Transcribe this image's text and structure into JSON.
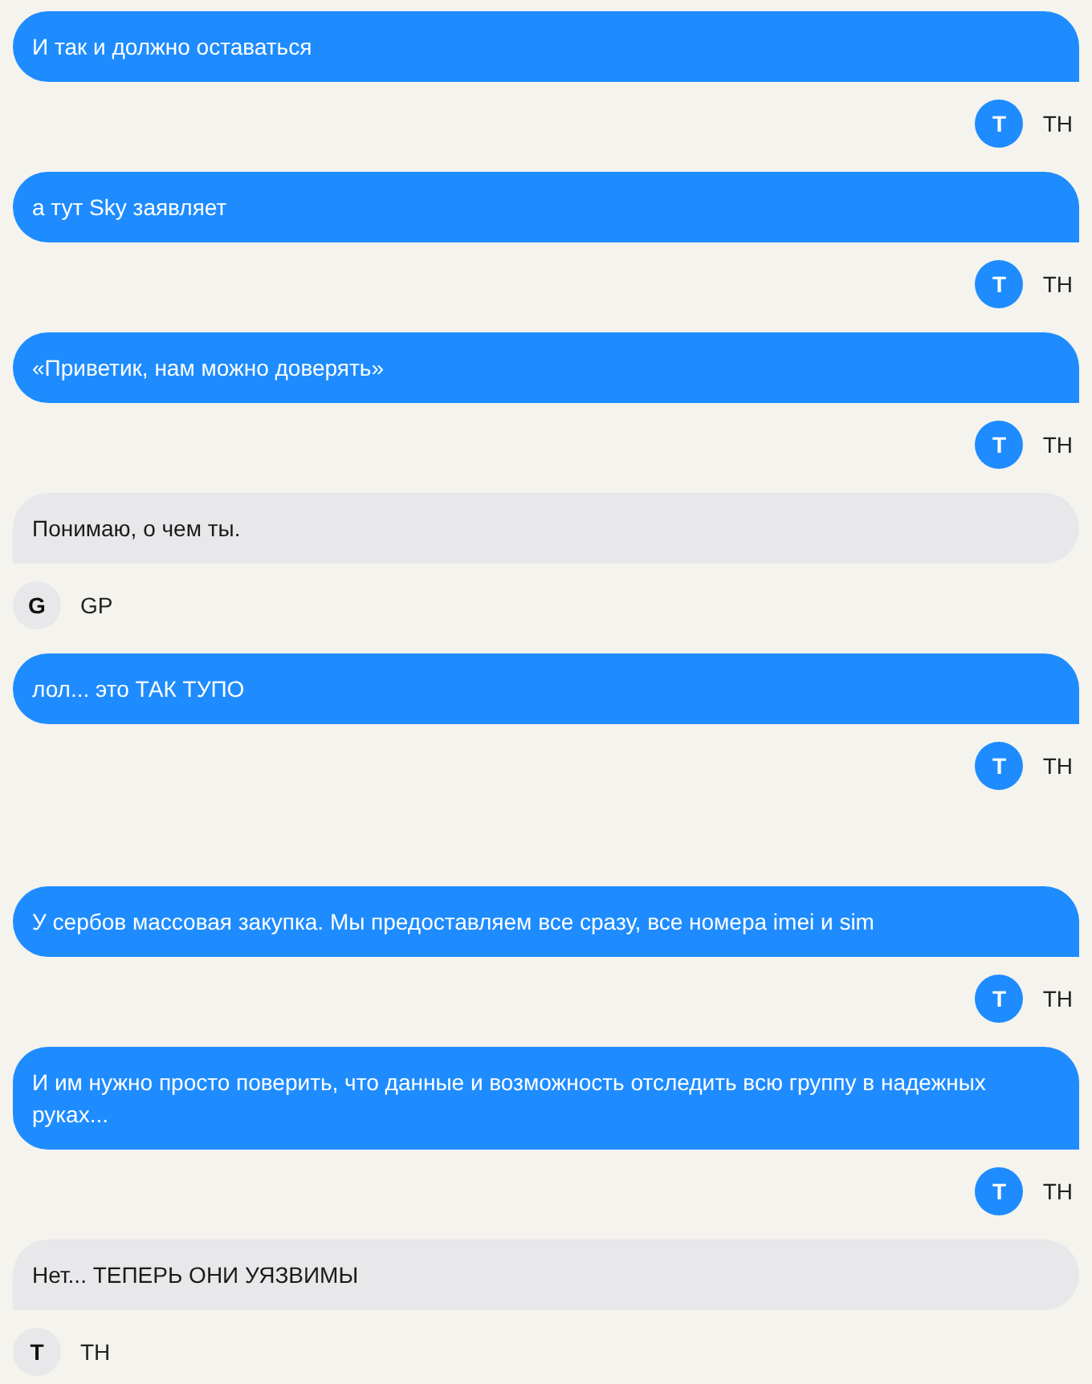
{
  "blocks": [
    {
      "messages": [
        {
          "kind": "outgoing",
          "text": "И так и должно оставаться",
          "avatar": "T",
          "name": "TH"
        },
        {
          "kind": "outgoing",
          "text": "а тут Sky заявляет",
          "avatar": "T",
          "name": "TH"
        },
        {
          "kind": "outgoing",
          "text": "«Приветик, нам можно доверять»",
          "avatar": "T",
          "name": "TH"
        },
        {
          "kind": "incoming",
          "text": "Понимаю, о чем ты.",
          "avatar": "G",
          "name": "GP"
        },
        {
          "kind": "outgoing",
          "text": "лол... это ТАК ТУПО",
          "avatar": "T",
          "name": "TH"
        }
      ]
    },
    {
      "messages": [
        {
          "kind": "outgoing",
          "text": "У сербов массовая закупка. Мы предоставляем все сразу, все номера imei и sim",
          "avatar": "T",
          "name": "TH"
        },
        {
          "kind": "outgoing",
          "text": "И им нужно просто поверить, что данные и возможность отследить всю группу в надежных руках...",
          "avatar": "T",
          "name": "TH"
        },
        {
          "kind": "incoming",
          "text": "Нет... ТЕПЕРЬ ОНИ УЯЗВИМЫ",
          "avatar": "T",
          "name": "TH"
        }
      ]
    }
  ]
}
